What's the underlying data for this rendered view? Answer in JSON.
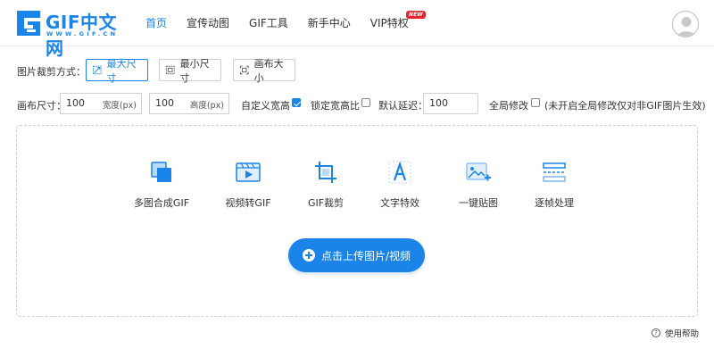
{
  "header": {
    "logo_text": "GIF中文网",
    "logo_sub": "WWW.GIF.CN",
    "nav": [
      {
        "label": "首页",
        "active": true
      },
      {
        "label": "宣传动图",
        "active": false
      },
      {
        "label": "GIF工具",
        "active": false
      },
      {
        "label": "新手中心",
        "active": false
      },
      {
        "label": "VIP特权",
        "active": false,
        "badge": "NEW"
      }
    ],
    "avatar_icon": "user-avatar-icon"
  },
  "crop": {
    "label": "图片裁剪方式：",
    "modes": [
      {
        "label": "最大尺寸",
        "icon": "max-size-icon",
        "selected": true
      },
      {
        "label": "最小尺寸",
        "icon": "min-size-icon",
        "selected": false
      },
      {
        "label": "画布大小",
        "icon": "canvas-size-icon",
        "selected": false
      }
    ]
  },
  "canvas": {
    "label": "画布尺寸：",
    "width_value": "100",
    "width_unit": "宽度(px)",
    "height_value": "100",
    "height_unit": "高度(px)",
    "custom_label": "自定义宽高",
    "custom_checked": true,
    "lock_label": "锁定宽高比",
    "lock_checked": false,
    "delay_label": "默认延迟：",
    "delay_value": "100",
    "global_label": "全局修改",
    "global_checked": false,
    "global_note": "(未开启全局修改仅对非GIF图片生效)"
  },
  "tools": [
    {
      "label": "多图合成GIF",
      "icon": "multi-image-icon"
    },
    {
      "label": "视频转GIF",
      "icon": "video-icon"
    },
    {
      "label": "GIF裁剪",
      "icon": "crop-icon"
    },
    {
      "label": "文字特效",
      "icon": "text-effect-icon"
    },
    {
      "label": "一键贴图",
      "icon": "add-image-icon"
    },
    {
      "label": "逐帧处理",
      "icon": "frames-icon"
    }
  ],
  "upload": {
    "label": "点击上传图片/视频"
  },
  "help": {
    "label": "使用帮助"
  },
  "colors": {
    "accent": "#1a84e8",
    "badge": "#e8242a"
  }
}
